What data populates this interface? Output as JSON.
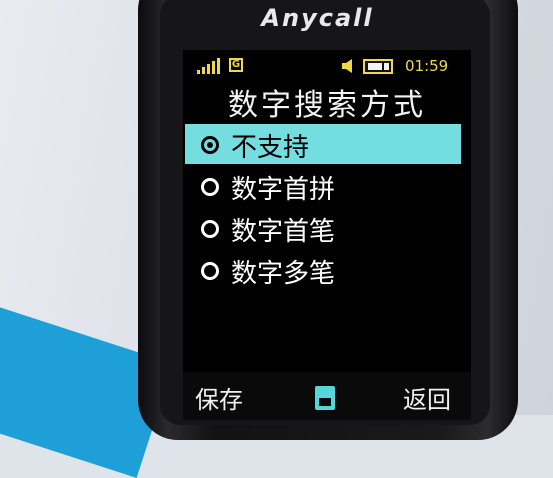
{
  "device": {
    "brand": "Anycall"
  },
  "status_bar": {
    "signal_icon": "signal-bars-icon",
    "network_indicator": "G",
    "speaker_icon": "speaker-icon",
    "battery_icon": "battery-icon",
    "time": "01:59"
  },
  "screen": {
    "title": "数字搜索方式",
    "options": [
      {
        "label": "不支持",
        "selected": true
      },
      {
        "label": "数字首拼",
        "selected": false
      },
      {
        "label": "数字首笔",
        "selected": false
      },
      {
        "label": "数字多笔",
        "selected": false
      }
    ]
  },
  "softkeys": {
    "left": "保存",
    "center_icon": "memory-card-icon",
    "right": "返回"
  },
  "colors": {
    "status_accent": "#f1d84a",
    "selection_highlight": "#74dde0",
    "screen_background": "#000000"
  }
}
